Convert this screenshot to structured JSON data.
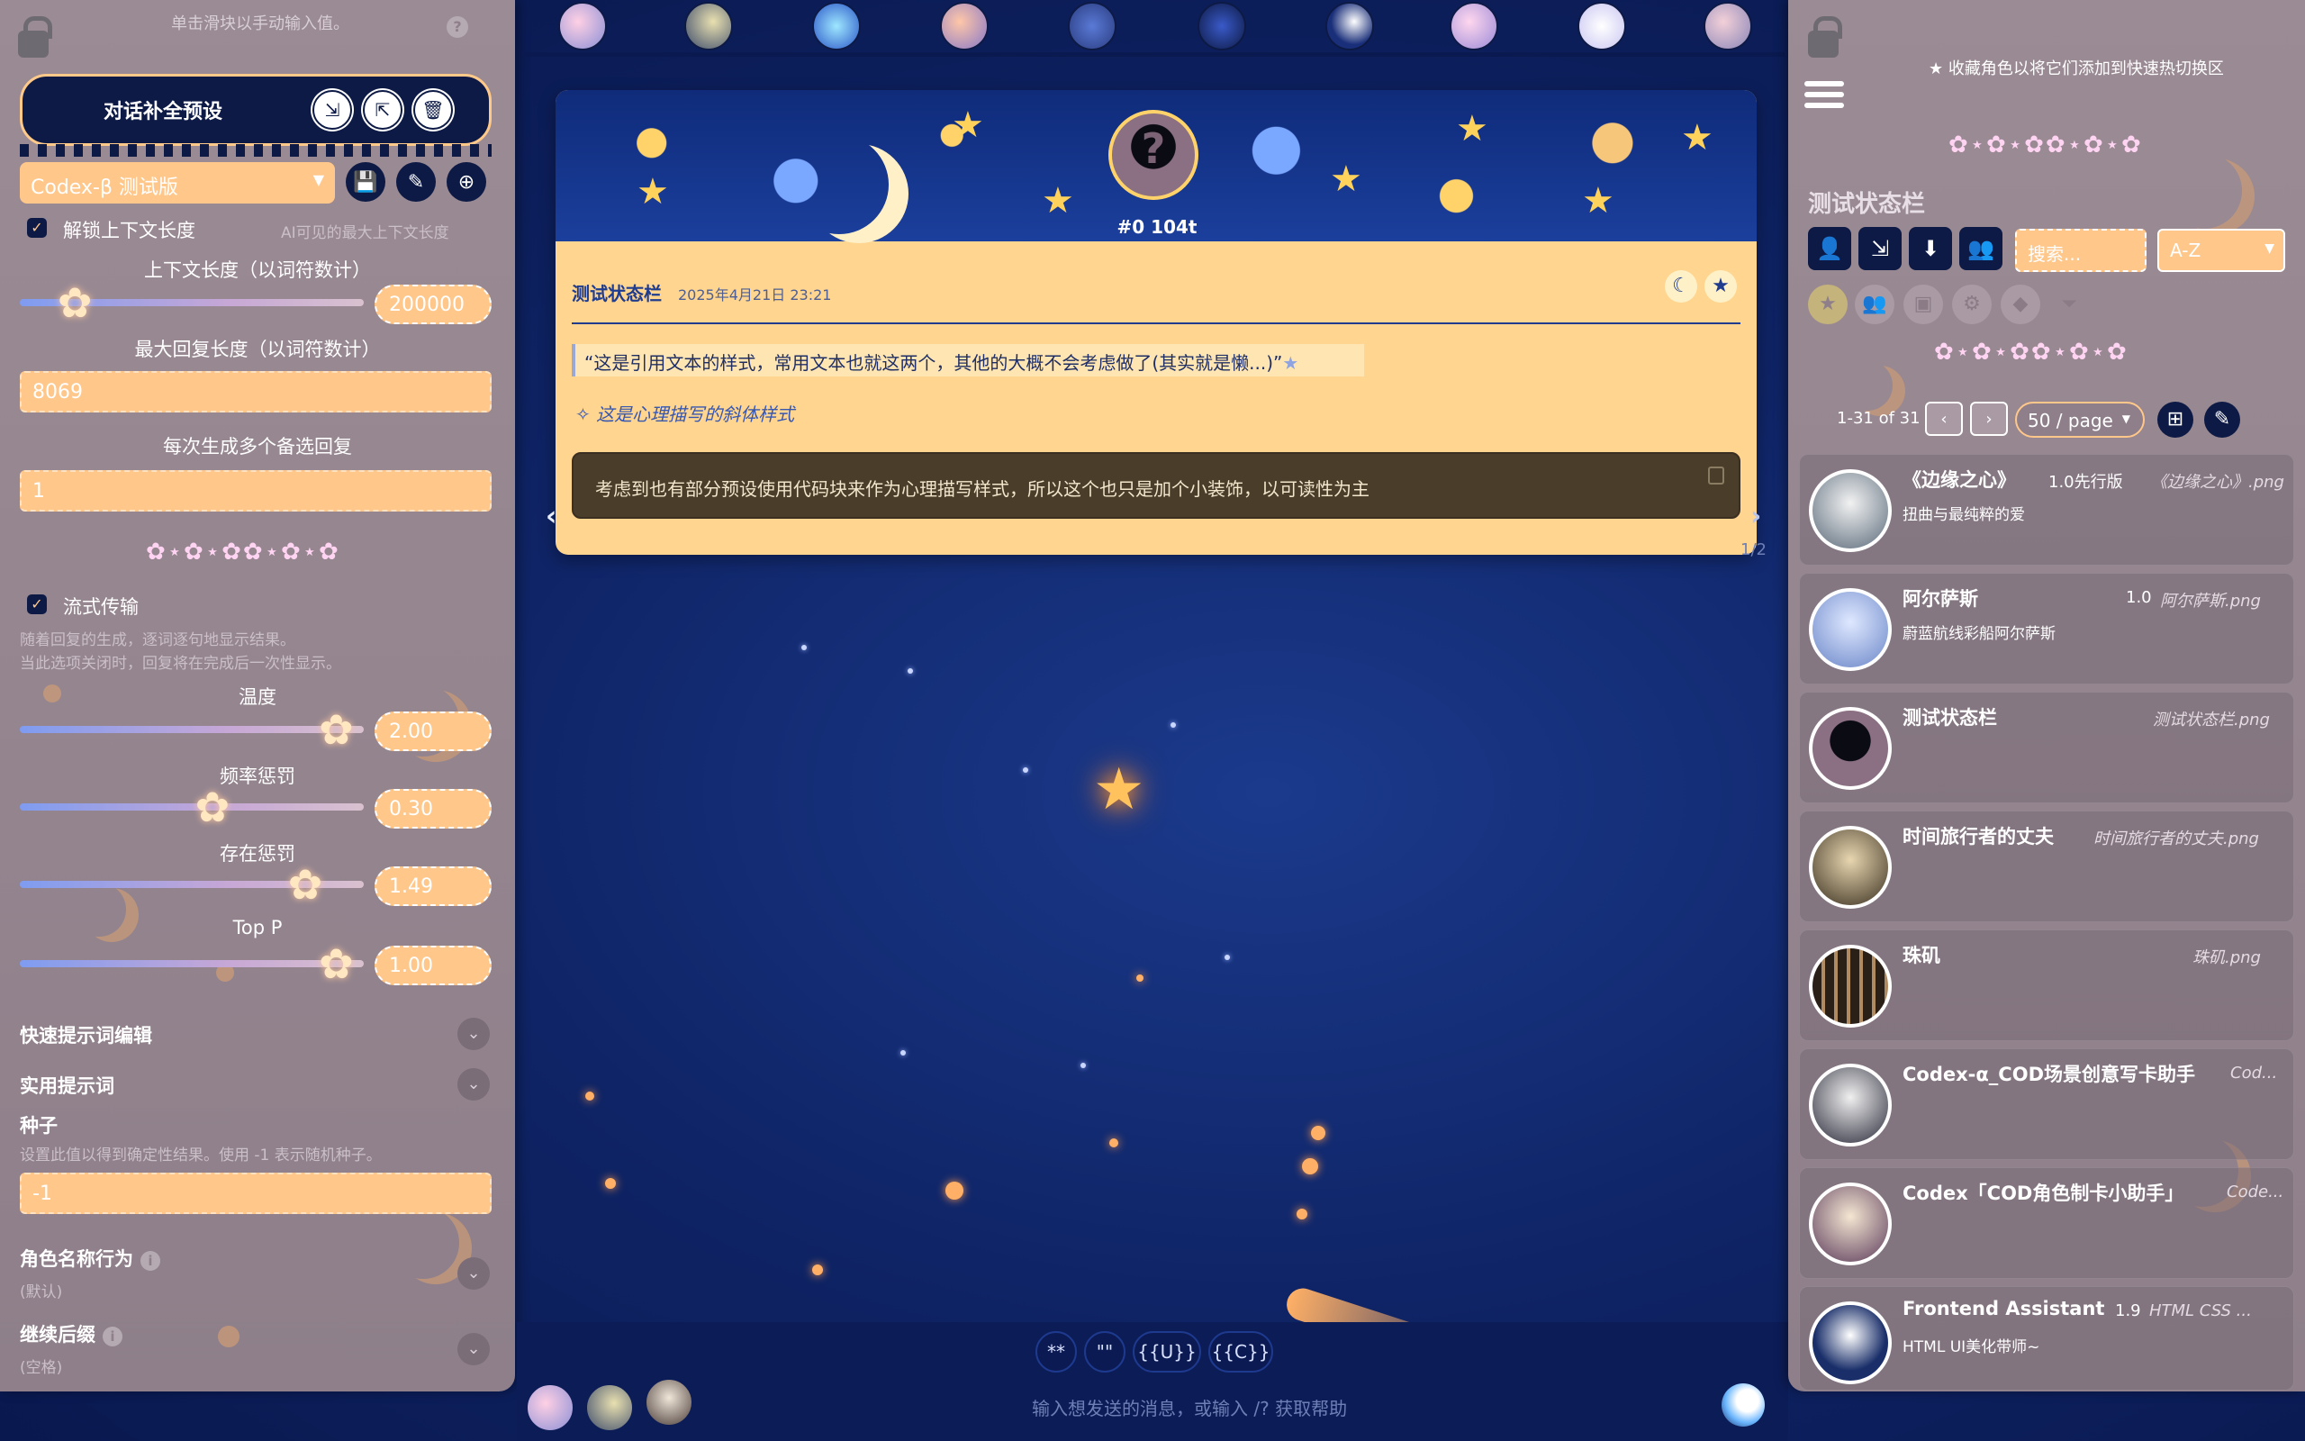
{
  "left_panel": {
    "top_hint": "单击滑块以手动输入值。",
    "preset_title": "对话补全预设",
    "preset_select": "Codex-β 测试版",
    "unlock_context_label": "解锁上下文长度",
    "unlock_context_hint": "AI可见的最大上下文长度",
    "context_len_label": "上下文长度（以词符数计）",
    "context_len_value": "200000",
    "max_response_label": "最大回复长度（以词符数计）",
    "max_response_value": "8069",
    "swipes_label": "每次生成多个备选回复",
    "swipes_value": "1",
    "stream_label": "流式传输",
    "stream_desc_1": "随着回复的生成，逐词逐句地显示结果。",
    "stream_desc_2": "当此选项关闭时，回复将在完成后一次性显示。",
    "temperature_label": "温度",
    "temperature_value": "2.00",
    "freq_penalty_label": "频率惩罚",
    "freq_penalty_value": "0.30",
    "presence_penalty_label": "存在惩罚",
    "presence_penalty_value": "1.49",
    "top_p_label": "Top P",
    "top_p_value": "1.00",
    "quick_prompts_label": "快速提示词编辑",
    "utility_prompts_label": "实用提示词",
    "seed_label": "种子",
    "seed_desc": "设置此值以得到确定性结果。使用 -1 表示随机种子。",
    "seed_value": "-1",
    "char_name_behavior_label": "角色名称行为",
    "char_name_behavior_value": "(默认)",
    "continue_suffix_label": "继续后缀",
    "continue_suffix_value": "(空格)",
    "deco_row": "✿⋆✿⋆✿✿⋆✿⋆✿",
    "slider_levels": {
      "context_len": 0.16,
      "temperature": 0.92,
      "freq_penalty": 0.56,
      "presence_penalty": 0.83,
      "top_p": 0.92
    }
  },
  "chat": {
    "message_id": "#0 104t",
    "char_name": "测试状态栏",
    "timestamp": "2025年4月21日 23:21",
    "quote_text": "“这是引用文本的样式，常用文本也就这两个，其他的大概不会考虑做了(其实就是懒...)”",
    "thought_text": "这是心理描写的斜体样式",
    "code_text": "考虑到也有部分预设使用代码块来作为心理描写样式，所以这个也只是加个小装饰，以可读性为主",
    "swipe_counter": "1/2"
  },
  "input": {
    "quick_buttons": [
      "**",
      "\"\"",
      "{{U}}",
      "{{C}}"
    ],
    "placeholder": "输入想发送的消息，或输入 /? 获取帮助"
  },
  "right_panel": {
    "fav_hint": "收藏角色以将它们添加到快速热切换区",
    "title": "测试状态栏",
    "search_placeholder": "搜索...",
    "sort_value": "A-Z",
    "page_info": "1-31 of 31",
    "page_size": "50 / page",
    "deco_row": "✿⋆✿⋆✿✿⋆✿⋆✿",
    "characters": [
      {
        "name": "《边缘之心》",
        "version": "1.0先行版",
        "file": "《边缘之心》.png",
        "desc": "扭曲与最纯粹的爱"
      },
      {
        "name": "阿尔萨斯",
        "version": "1.0",
        "file": "阿尔萨斯.png",
        "desc": "蔚蓝航线彩船阿尔萨斯"
      },
      {
        "name": "测试状态栏",
        "version": "",
        "file": "测试状态栏.png",
        "desc": ""
      },
      {
        "name": "时间旅行者的丈夫",
        "version": "",
        "file": "时间旅行者的丈夫.png",
        "desc": ""
      },
      {
        "name": "珠矶",
        "version": "",
        "file": "珠矶.png",
        "desc": ""
      },
      {
        "name": "Codex-α_COD场景创意写卡助手",
        "version": "",
        "file": "Cod...",
        "desc": ""
      },
      {
        "name": "Codex「COD角色制卡小助手」",
        "version": "",
        "file": "Code...",
        "desc": ""
      },
      {
        "name": "Frontend Assistant",
        "version": "1.9",
        "file": "HTML CSS ...",
        "desc": "HTML UI美化带师~"
      }
    ]
  },
  "colors": {
    "accent": "#ffc78a",
    "navy": "#0d1a45",
    "panel": "#8e7f8a",
    "card": "#ffd58f"
  }
}
